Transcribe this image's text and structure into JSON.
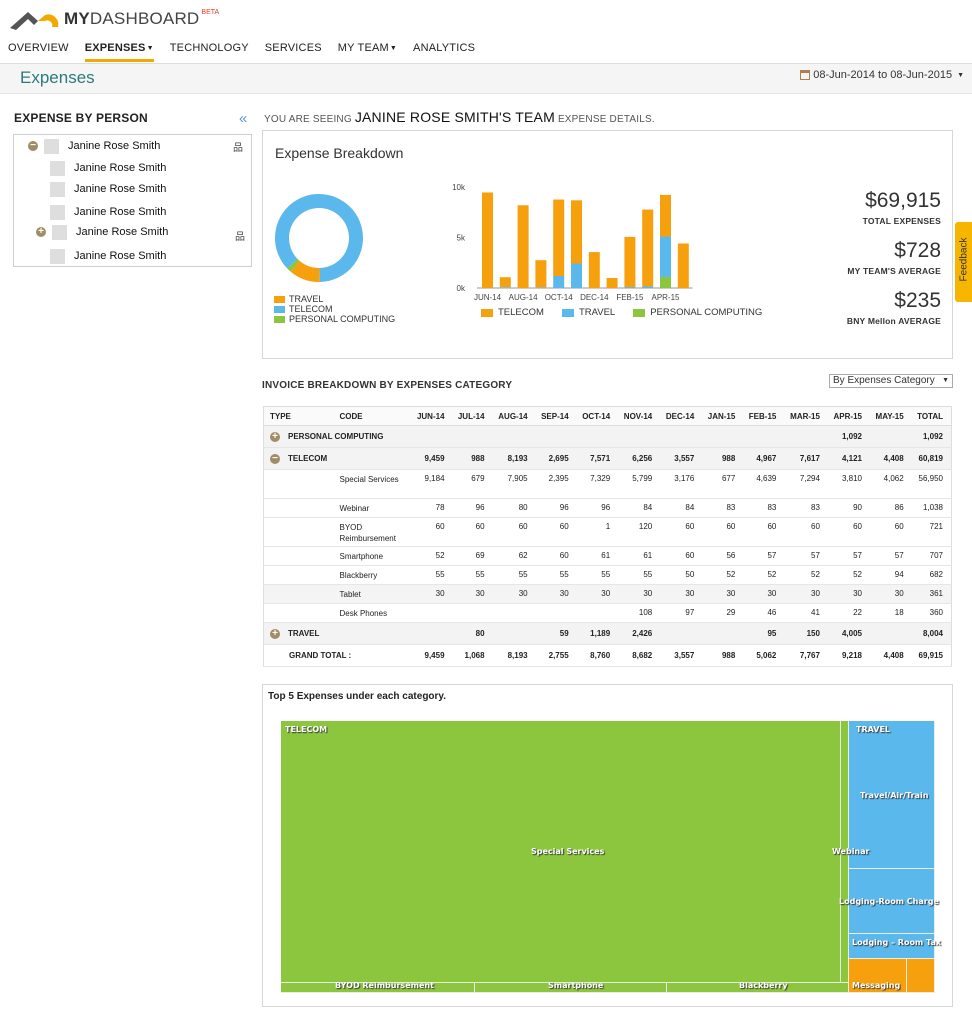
{
  "app": {
    "logo_my": "MY",
    "logo_dash": "DASHBOARD",
    "logo_beta": "BETA"
  },
  "nav": {
    "items": [
      {
        "label": "OVERVIEW",
        "active": false,
        "dropdown": false
      },
      {
        "label": "EXPENSES",
        "active": true,
        "dropdown": true
      },
      {
        "label": "TECHNOLOGY",
        "active": false,
        "dropdown": false
      },
      {
        "label": "SERVICES",
        "active": false,
        "dropdown": false
      },
      {
        "label": "MY TEAM",
        "active": false,
        "dropdown": true
      },
      {
        "label": "ANALYTICS",
        "active": false,
        "dropdown": false
      }
    ]
  },
  "page": {
    "title": "Expenses",
    "date_range": "08-Jun-2014 to 08-Jun-2015"
  },
  "sidebar": {
    "title": "EXPENSE BY PERSON",
    "people": [
      {
        "name": "Janine Rose Smith",
        "toggle": "minus",
        "org": true
      },
      {
        "name": "Janine Rose Smith",
        "toggle": "",
        "org": false
      },
      {
        "name": "Janine Rose Smith",
        "toggle": "",
        "org": false
      },
      {
        "name": "Janine Rose Smith",
        "toggle": "",
        "org": false
      },
      {
        "name": "Janine Rose Smith",
        "toggle": "plus",
        "org": true
      },
      {
        "name": "Janine Rose Smith",
        "toggle": "",
        "org": false
      }
    ]
  },
  "main": {
    "seeing_prefix": "YOU ARE SEEING",
    "seeing_team": "JANINE ROSE SMITH'S TEAM",
    "seeing_suffix": "EXPENSE DETAILS.",
    "breakdown_title": "Expense Breakdown",
    "stats": [
      {
        "value": "$69,915",
        "label": "TOTAL EXPENSES"
      },
      {
        "value": "$728",
        "label": "MY TEAM'S AVERAGE"
      },
      {
        "value": "$235",
        "label": "BNY Mellon AVERAGE"
      }
    ],
    "invoice_title": "INVOICE BREAKDOWN BY EXPENSES CATEGORY",
    "category_select": "By Expenses Category",
    "treemap_title": "Top 5 Expenses under each category.",
    "feedback_label": "Feedback"
  },
  "colors": {
    "telecom": "#f7a00e",
    "travel": "#5bb8ed",
    "personal_computing": "#8cc63f",
    "accent": "#f2a900",
    "title_teal": "#2c7a7b"
  },
  "chart_data": [
    {
      "type": "pie",
      "style": "donut",
      "legend": [
        "TRAVEL",
        "TELECOM",
        "PERSONAL COMPUTING"
      ],
      "slices": [
        {
          "name": "TELECOM",
          "value": 60819
        },
        {
          "name": "TRAVEL",
          "value": 8004
        },
        {
          "name": "PERSONAL COMPUTING",
          "value": 1092
        }
      ]
    },
    {
      "type": "bar",
      "stacked": true,
      "categories": [
        "JUN-14",
        "JUL-14",
        "AUG-14",
        "SEP-14",
        "OCT-14",
        "NOV-14",
        "DEC-14",
        "JAN-15",
        "FEB-15",
        "MAR-15",
        "APR-15",
        "MAY-15"
      ],
      "tick_labels_x": [
        "JUN-14",
        "AUG-14",
        "OCT-14",
        "DEC-14",
        "FEB-15",
        "APR-15"
      ],
      "tick_labels_y": [
        "10k",
        "5k",
        "0k"
      ],
      "ylim": [
        0,
        10000
      ],
      "legend": [
        "TELECOM",
        "TRAVEL",
        "PERSONAL COMPUTING"
      ],
      "series": [
        {
          "name": "PERSONAL COMPUTING",
          "values": [
            0,
            0,
            0,
            0,
            0,
            0,
            0,
            0,
            0,
            0,
            1092,
            0
          ]
        },
        {
          "name": "TRAVEL",
          "values": [
            0,
            80,
            0,
            59,
            1189,
            2426,
            0,
            0,
            95,
            150,
            4005,
            0
          ]
        },
        {
          "name": "TELECOM",
          "values": [
            9459,
            988,
            8193,
            2695,
            7571,
            6256,
            3557,
            988,
            4967,
            7617,
            4121,
            4408
          ]
        }
      ]
    },
    {
      "type": "table",
      "columns": [
        "TYPE",
        "CODE",
        "JUN-14",
        "JUL-14",
        "AUG-14",
        "SEP-14",
        "OCT-14",
        "NOV-14",
        "DEC-14",
        "JAN-15",
        "FEB-15",
        "MAR-15",
        "APR-15",
        "MAY-15",
        "TOTAL"
      ],
      "rows": [
        {
          "kind": "cat",
          "toggle": "+",
          "type": "PERSONAL COMPUTING",
          "code": "",
          "values": [
            "",
            "",
            "",
            "",
            "",
            "",
            "",
            "",
            "",
            "",
            "1,092",
            "",
            "1,092"
          ]
        },
        {
          "kind": "cat",
          "toggle": "−",
          "type": "TELECOM",
          "code": "",
          "values": [
            "9,459",
            "988",
            "8,193",
            "2,695",
            "7,571",
            "6,256",
            "3,557",
            "988",
            "4,967",
            "7,617",
            "4,121",
            "4,408",
            "60,819"
          ]
        },
        {
          "kind": "sub",
          "type": "",
          "code": "Special Services",
          "values": [
            "9,184",
            "679",
            "7,905",
            "2,395",
            "7,329",
            "5,799",
            "3,176",
            "677",
            "4,639",
            "7,294",
            "3,810",
            "4,062",
            "56,950"
          ]
        },
        {
          "kind": "sub",
          "type": "",
          "code": "Webinar",
          "values": [
            "78",
            "96",
            "80",
            "96",
            "96",
            "84",
            "84",
            "83",
            "83",
            "83",
            "90",
            "86",
            "1,038"
          ]
        },
        {
          "kind": "sub",
          "type": "",
          "code": "BYOD Reimbursement",
          "values": [
            "60",
            "60",
            "60",
            "60",
            "1",
            "120",
            "60",
            "60",
            "60",
            "60",
            "60",
            "60",
            "721"
          ]
        },
        {
          "kind": "sub",
          "type": "",
          "code": "Smartphone",
          "values": [
            "52",
            "69",
            "62",
            "60",
            "61",
            "61",
            "60",
            "56",
            "57",
            "57",
            "57",
            "57",
            "707"
          ]
        },
        {
          "kind": "sub",
          "type": "",
          "code": "Blackberry",
          "values": [
            "55",
            "55",
            "55",
            "55",
            "55",
            "55",
            "50",
            "52",
            "52",
            "52",
            "52",
            "94",
            "682"
          ]
        },
        {
          "kind": "shade",
          "type": "",
          "code": "Tablet",
          "values": [
            "30",
            "30",
            "30",
            "30",
            "30",
            "30",
            "30",
            "30",
            "30",
            "30",
            "30",
            "30",
            "361"
          ]
        },
        {
          "kind": "sub",
          "type": "",
          "code": "Desk Phones",
          "values": [
            "",
            "",
            "",
            "",
            "",
            "108",
            "97",
            "29",
            "46",
            "41",
            "22",
            "18",
            "360"
          ]
        },
        {
          "kind": "cat",
          "toggle": "+",
          "type": "TRAVEL",
          "code": "",
          "values": [
            "",
            "80",
            "",
            "59",
            "1,189",
            "2,426",
            "",
            "",
            "95",
            "150",
            "4,005",
            "",
            "8,004"
          ]
        },
        {
          "kind": "total",
          "type": "GRAND TOTAL :",
          "code": "",
          "values": [
            "9,459",
            "1,068",
            "8,193",
            "2,755",
            "8,760",
            "8,682",
            "3,557",
            "988",
            "5,062",
            "7,767",
            "9,218",
            "4,408",
            "69,915"
          ]
        }
      ]
    },
    {
      "type": "treemap",
      "groups": [
        {
          "name": "TELECOM",
          "items": [
            "Special Services",
            "Webinar",
            "BYOD Reimbursement",
            "Smartphone",
            "Blackberry"
          ]
        },
        {
          "name": "TRAVEL",
          "items": [
            "Travel/Air/Train",
            "Lodging-Room Charge",
            "Lodging – Room Tax",
            "Messaging"
          ]
        }
      ]
    }
  ]
}
